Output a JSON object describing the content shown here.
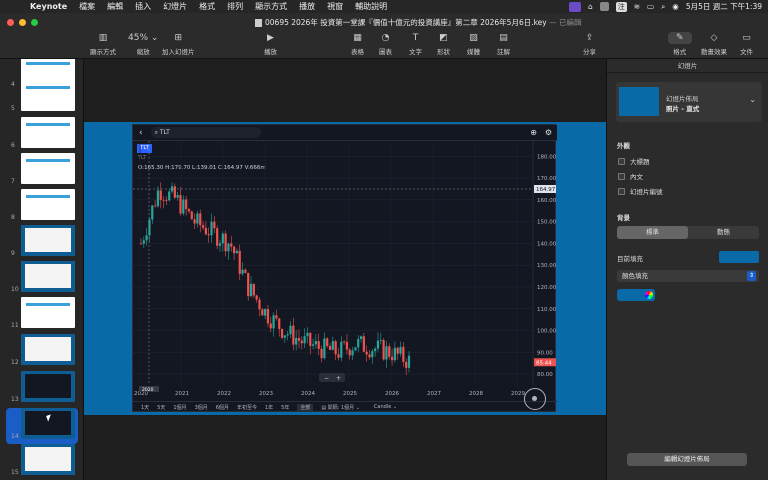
{
  "menubar": {
    "app_name": "Keynote",
    "items": [
      "檔案",
      "編輯",
      "插入",
      "幻燈片",
      "格式",
      "排列",
      "顯示方式",
      "播放",
      "視窗",
      "輔助說明"
    ],
    "status": {
      "input_method": "注",
      "battery_label": "",
      "date_time": "5月5日 週二 下午1:39"
    }
  },
  "window": {
    "title": "00695 2026年 投資第一堂課『價值十億元的投資講座』第二章  2026年5月6日.key",
    "edited": "— 已編輯",
    "toolbar": [
      {
        "label": "顯示方式",
        "icon": "sidebar-icon"
      },
      {
        "label": "縮放",
        "value": "45%",
        "icon": "zoom-icon"
      },
      {
        "label": "加入幻燈片",
        "icon": "add-slide-icon"
      },
      {
        "label": "播放",
        "icon": "play-icon"
      },
      {
        "label": "表格",
        "icon": "table-icon"
      },
      {
        "label": "圖表",
        "icon": "chart-icon"
      },
      {
        "label": "文字",
        "icon": "text-icon"
      },
      {
        "label": "形狀",
        "icon": "shape-icon"
      },
      {
        "label": "媒體",
        "icon": "media-icon"
      },
      {
        "label": "註解",
        "icon": "comment-icon"
      },
      {
        "label": "分享",
        "icon": "share-icon"
      },
      {
        "label": "格式",
        "icon": "format-icon"
      },
      {
        "label": "動畫效果",
        "icon": "animate-icon"
      },
      {
        "label": "文件",
        "icon": "document-icon"
      }
    ]
  },
  "sidebar": {
    "slides": [
      {
        "num": "4",
        "kind": "light"
      },
      {
        "num": "5",
        "kind": "light"
      },
      {
        "num": "6",
        "kind": "light"
      },
      {
        "num": "7",
        "kind": "light"
      },
      {
        "num": "8",
        "kind": "light"
      },
      {
        "num": "9",
        "kind": "blue"
      },
      {
        "num": "10",
        "kind": "blue"
      },
      {
        "num": "11",
        "kind": "light"
      },
      {
        "num": "12",
        "kind": "blue"
      },
      {
        "num": "13",
        "kind": "blue"
      },
      {
        "num": "14",
        "kind": "blue"
      },
      {
        "num": "15",
        "kind": "blue"
      }
    ],
    "selected": "14"
  },
  "chart": {
    "symbol": "TLT",
    "search_text": "TLT",
    "ohlc": "O:165.30  H:179.70  L:139.01  C:164.97  V:666m",
    "y_ticks": [
      "180.00",
      "170.00",
      "160.00",
      "150.00",
      "140.00",
      "130.00",
      "120.00",
      "110.00",
      "100.00",
      "90.00",
      "80.00"
    ],
    "x_ticks": [
      "2020",
      "2021",
      "2022",
      "2023",
      "2024",
      "2025",
      "2026",
      "2027",
      "2028",
      "2029"
    ],
    "price_label_top": "164.97",
    "price_label_bottom": "85.44",
    "ranges": [
      "1天",
      "5天",
      "1個月",
      "3個月",
      "6個月",
      "年初至今",
      "1年",
      "5年",
      "全部"
    ],
    "active_range": "全部",
    "interval_label": "間隔:",
    "interval_value": "1個月",
    "chart_style": "Candle",
    "crosshair_date": "2020",
    "zoom_minus": "−",
    "zoom_plus": "+"
  },
  "chart_data": {
    "type": "candlestick",
    "series": [
      {
        "name": "TLT",
        "values_approx_close": [
          140,
          165,
          160,
          150,
          145,
          140,
          120,
          108,
          100,
          95,
          92,
          90,
          94,
          92,
          90,
          86
        ]
      }
    ],
    "ylim": [
      80,
      185
    ]
  },
  "inspector": {
    "header": "幻燈片",
    "layout_label": "幻燈片佈局",
    "layout_value": "照片 - 直式",
    "appearance_title": "外觀",
    "checkboxes": [
      "大標題",
      "內文",
      "幻燈片編號"
    ],
    "background_title": "背景",
    "bg_tabs": [
      "標準",
      "動態"
    ],
    "current_fill_label": "目前填充",
    "fill_type": "顏色填充",
    "edit_layout_button": "編輯幻燈片佈局"
  }
}
